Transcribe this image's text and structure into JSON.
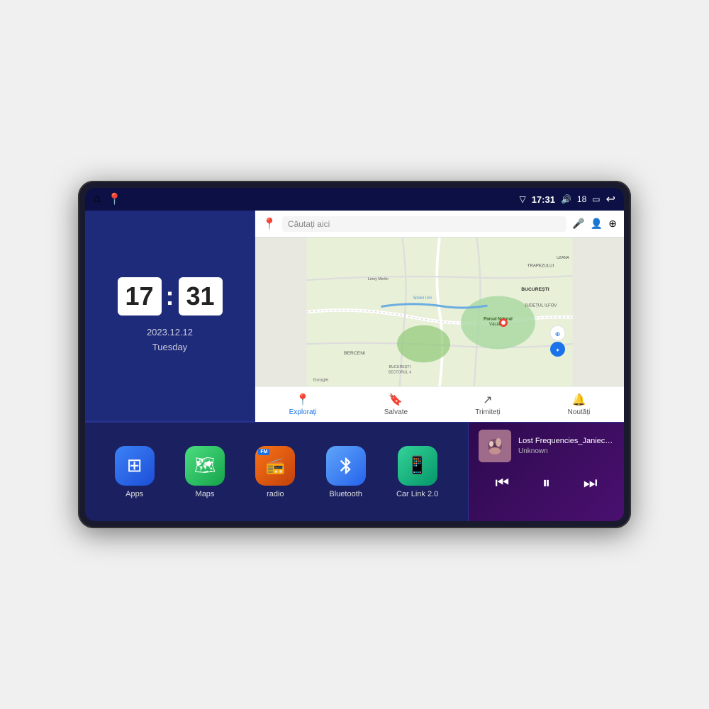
{
  "device": {
    "status_bar": {
      "time": "17:31",
      "signal_icon": "▽",
      "volume_icon": "🔊",
      "battery_level": "18",
      "battery_icon": "▭",
      "back_icon": "↩",
      "nav_home_icon": "⌂",
      "nav_maps_icon": "📍"
    },
    "clock": {
      "hours": "17",
      "minutes": "31",
      "date": "2023.12.12",
      "day": "Tuesday"
    },
    "map": {
      "search_placeholder": "Căutați aici",
      "footer_items": [
        {
          "label": "Explorați",
          "active": true,
          "icon": "📍"
        },
        {
          "label": "Salvate",
          "active": false,
          "icon": "🔖"
        },
        {
          "label": "Trimiteți",
          "active": false,
          "icon": "↗"
        },
        {
          "label": "Noutăți",
          "active": false,
          "icon": "🔔"
        }
      ],
      "locations": [
        "BUCUREȘTI",
        "JUDEȚUL ILFOV",
        "TRAPEZULUI",
        "BERCENI",
        "BUCUREȘTI SECTORUL 4",
        "Leroy Merlin",
        "Parcul Natural Văcărești",
        "Splaiuri Unirii",
        "UZANA"
      ],
      "google_label": "Google"
    },
    "apps": [
      {
        "id": "apps",
        "label": "Apps",
        "bg": "bg-apps",
        "icon": "⊞"
      },
      {
        "id": "maps",
        "label": "Maps",
        "bg": "bg-maps",
        "icon": "🗺"
      },
      {
        "id": "radio",
        "label": "radio",
        "bg": "bg-radio",
        "icon": "📻"
      },
      {
        "id": "bluetooth",
        "label": "Bluetooth",
        "bg": "bg-bt",
        "icon": "⊛"
      },
      {
        "id": "carlink",
        "label": "Car Link 2.0",
        "bg": "bg-car",
        "icon": "📱"
      }
    ],
    "music": {
      "title": "Lost Frequencies_Janieck Devy-...",
      "artist": "Unknown",
      "thumb_icon": "🎵",
      "prev_icon": "⏮",
      "play_icon": "⏸",
      "next_icon": "⏭"
    }
  }
}
